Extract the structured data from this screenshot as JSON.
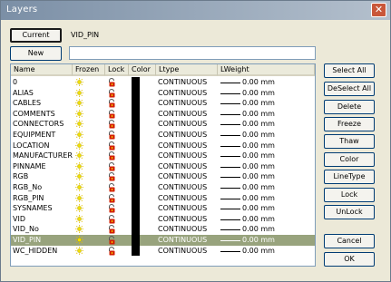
{
  "window": {
    "title": "Layers"
  },
  "current": {
    "button_label": "Current",
    "value": "VID_PIN"
  },
  "new": {
    "button_label": "New",
    "input_value": ""
  },
  "columns": [
    "Name",
    "Frozen",
    "Lock",
    "Color",
    "Ltype",
    "LWeight"
  ],
  "layers": [
    {
      "name": "0",
      "ltype": "CONTINUOUS",
      "lweight": "0.00 mm"
    },
    {
      "name": "ALIAS",
      "ltype": "CONTINUOUS",
      "lweight": "0.00 mm"
    },
    {
      "name": "CABLES",
      "ltype": "CONTINUOUS",
      "lweight": "0.00 mm"
    },
    {
      "name": "COMMENTS",
      "ltype": "CONTINUOUS",
      "lweight": "0.00 mm"
    },
    {
      "name": "CONNECTORS",
      "ltype": "CONTINUOUS",
      "lweight": "0.00 mm"
    },
    {
      "name": "EQUIPMENT",
      "ltype": "CONTINUOUS",
      "lweight": "0.00 mm"
    },
    {
      "name": "LOCATION",
      "ltype": "CONTINUOUS",
      "lweight": "0.00 mm"
    },
    {
      "name": "MANUFACTURER",
      "ltype": "CONTINUOUS",
      "lweight": "0.00 mm"
    },
    {
      "name": "PINNAME",
      "ltype": "CONTINUOUS",
      "lweight": "0.00 mm"
    },
    {
      "name": "RGB",
      "ltype": "CONTINUOUS",
      "lweight": "0.00 mm"
    },
    {
      "name": "RGB_No",
      "ltype": "CONTINUOUS",
      "lweight": "0.00 mm"
    },
    {
      "name": "RGB_PIN",
      "ltype": "CONTINUOUS",
      "lweight": "0.00 mm"
    },
    {
      "name": "SYSNAMES",
      "ltype": "CONTINUOUS",
      "lweight": "0.00 mm"
    },
    {
      "name": "VID",
      "ltype": "CONTINUOUS",
      "lweight": "0.00 mm"
    },
    {
      "name": "VID_No",
      "ltype": "CONTINUOUS",
      "lweight": "0.00 mm"
    },
    {
      "name": "VID_PIN",
      "ltype": "CONTINUOUS",
      "lweight": "0.00 mm",
      "selected": true
    },
    {
      "name": "WC_HIDDEN",
      "ltype": "CONTINUOUS",
      "lweight": "0.00 mm"
    }
  ],
  "buttons": {
    "select_all": "Select All",
    "deselect_all": "DeSelect All",
    "delete": "Delete",
    "freeze": "Freeze",
    "thaw": "Thaw",
    "color": "Color",
    "linetype": "LineType",
    "lock": "Lock",
    "unlock": "UnLock",
    "cancel": "Cancel",
    "ok": "OK"
  },
  "colors": {
    "selected_row": "#98a37d",
    "frozen_icon": "#f0e000",
    "lock_icon": "#d22000",
    "layer_color": "#000000"
  },
  "icons": {
    "frozen": "sun-icon",
    "lock": "padlock-icon"
  }
}
